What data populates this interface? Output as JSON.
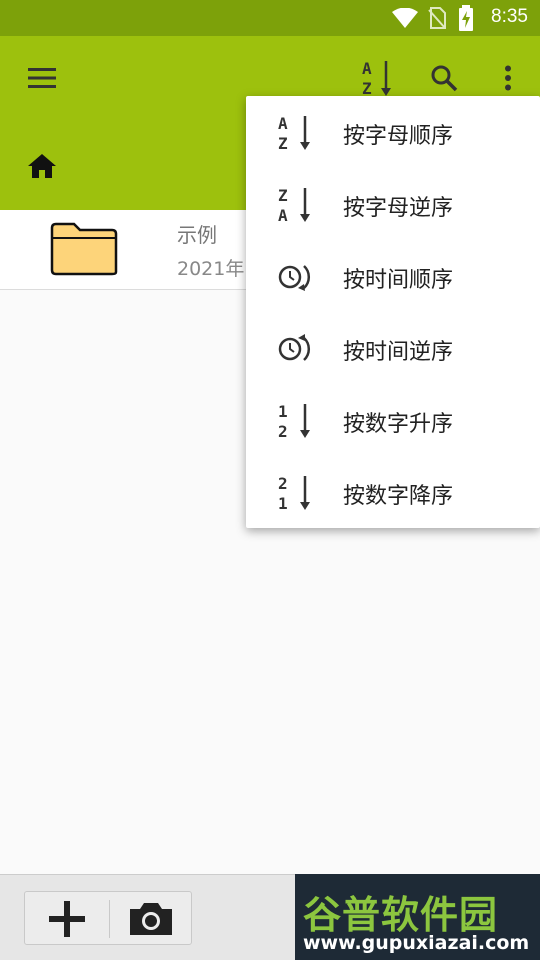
{
  "status_bar": {
    "time": "8:35"
  },
  "app_bar": {
    "menu_icon": "hamburger-icon",
    "sort_icon": "sort-az-icon",
    "search_icon": "search-icon",
    "overflow_icon": "more-vert-icon"
  },
  "path_bar": {
    "home_icon": "home-icon"
  },
  "file_list": [
    {
      "name": "示例",
      "date": "2021年",
      "icon": "folder-icon"
    }
  ],
  "sort_menu": {
    "items": [
      {
        "label": "按字母顺序",
        "icon": "sort-az-icon"
      },
      {
        "label": "按字母逆序",
        "icon": "sort-za-icon"
      },
      {
        "label": "按时间顺序",
        "icon": "clock-forward-icon"
      },
      {
        "label": "按时间逆序",
        "icon": "clock-backward-icon"
      },
      {
        "label": "按数字升序",
        "icon": "sort-12-icon"
      },
      {
        "label": "按数字降序",
        "icon": "sort-21-icon"
      }
    ]
  },
  "bottom_bar": {
    "add_icon": "plus-icon",
    "camera_icon": "camera-icon"
  },
  "watermark": {
    "brand": "谷普软件园",
    "url": "www.gupuxiazai.com"
  },
  "colors": {
    "status_bar": "#7da10a",
    "app_bar": "#9dc10d",
    "folder": "#fdd47a"
  }
}
